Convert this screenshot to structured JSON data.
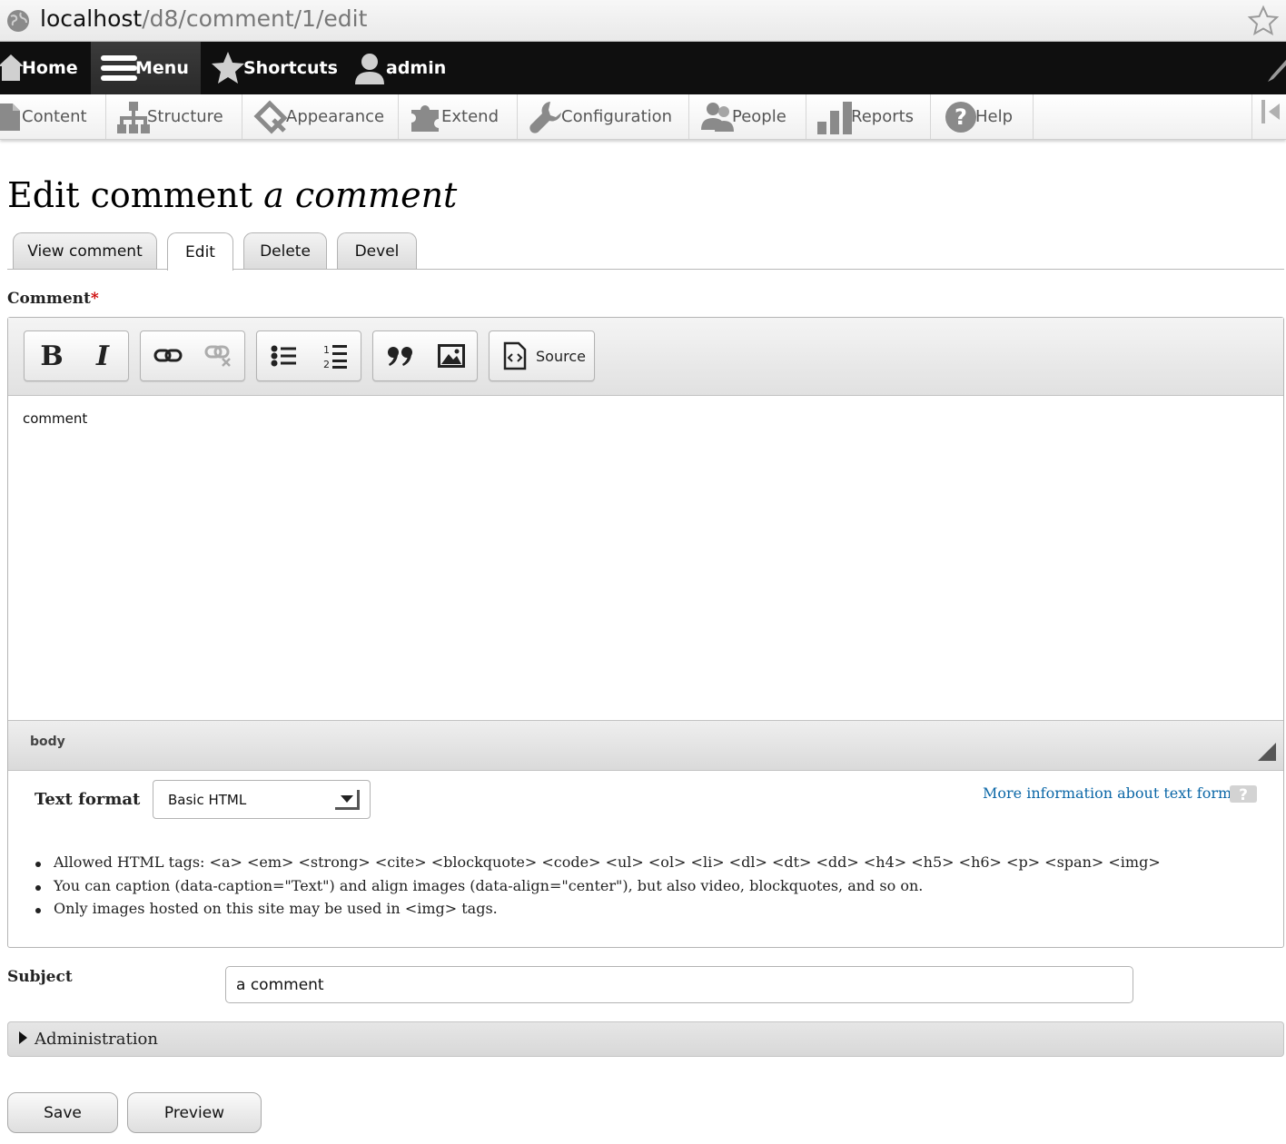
{
  "browser": {
    "url_host": "localhost",
    "url_path": "/d8/comment/1/edit"
  },
  "toolbar": {
    "items": [
      {
        "label": "Home",
        "icon": "home-icon"
      },
      {
        "label": "Menu",
        "icon": "hamburger-icon"
      },
      {
        "label": "Shortcuts",
        "icon": "star-icon"
      },
      {
        "label": "admin",
        "icon": "user-icon"
      }
    ],
    "active": "Menu"
  },
  "tray": {
    "items": [
      {
        "label": "Content",
        "icon": "document-icon"
      },
      {
        "label": "Structure",
        "icon": "sitemap-icon"
      },
      {
        "label": "Appearance",
        "icon": "brush-icon"
      },
      {
        "label": "Extend",
        "icon": "puzzle-icon"
      },
      {
        "label": "Configuration",
        "icon": "wrench-icon"
      },
      {
        "label": "People",
        "icon": "people-icon"
      },
      {
        "label": "Reports",
        "icon": "bar-chart-icon"
      },
      {
        "label": "Help",
        "icon": "help-icon"
      }
    ]
  },
  "page": {
    "title_prefix": "Edit comment",
    "title_subject": "a comment"
  },
  "tabs": [
    {
      "label": "View comment"
    },
    {
      "label": "Edit",
      "active": true
    },
    {
      "label": "Delete"
    },
    {
      "label": "Devel"
    }
  ],
  "comment": {
    "label": "Comment",
    "required_mark": "*",
    "editor": {
      "tools": [
        "bold",
        "italic",
        "link",
        "unlink",
        "bulleted-list",
        "numbered-list",
        "blockquote",
        "image"
      ],
      "source_label": "Source",
      "content": "comment",
      "path": "body"
    },
    "text_format": {
      "label": "Text format",
      "selected": "Basic HTML",
      "more_info": "More information about text formats",
      "tips": [
        "Allowed HTML tags: <a> <em> <strong> <cite> <blockquote> <code> <ul> <ol> <li> <dl> <dt> <dd> <h4> <h5> <h6> <p> <span> <img>",
        "You can caption (data-caption=\"Text\") and align images (data-align=\"center\"), but also video, blockquotes, and so on.",
        "Only images hosted on this site may be used in <img> tags."
      ]
    }
  },
  "subject": {
    "label": "Subject",
    "value": "a comment"
  },
  "administration": {
    "label": "Administration"
  },
  "actions": {
    "save": "Save",
    "preview": "Preview"
  },
  "colors": {
    "toolbar_bg": "#0f0f0f",
    "link": "#0b67a7",
    "required": "#cc0000"
  }
}
